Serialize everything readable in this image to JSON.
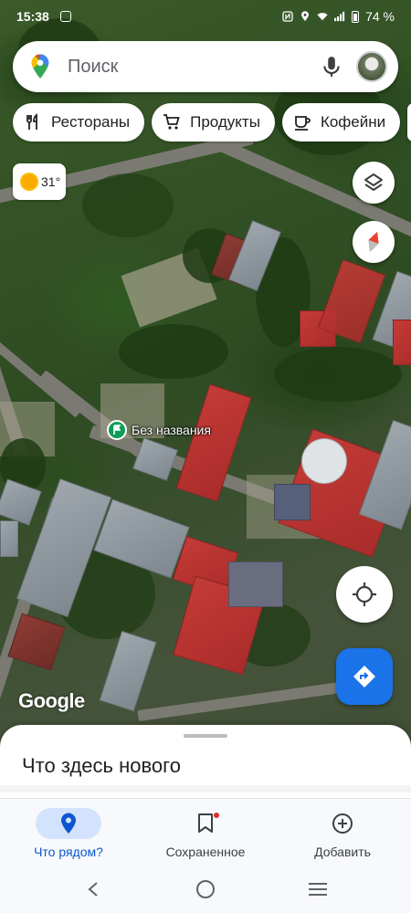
{
  "status_bar": {
    "time": "15:38",
    "battery": "74 %",
    "icons": [
      "instagram-icon",
      "nfc-icon",
      "location-icon",
      "wifi-icon",
      "signal-icon",
      "battery-icon"
    ]
  },
  "search": {
    "placeholder": "Поиск"
  },
  "chips": [
    {
      "label": "Рестораны",
      "icon": "restaurant-icon"
    },
    {
      "label": "Продукты",
      "icon": "cart-icon"
    },
    {
      "label": "Кофейни",
      "icon": "coffee-icon"
    }
  ],
  "weather": {
    "temperature": "31°",
    "icon": "sun-icon"
  },
  "map": {
    "marker_label": "Без названия",
    "logo": "Google"
  },
  "sheet": {
    "title": "Что здесь нового"
  },
  "bottom_nav": {
    "items": [
      {
        "label": "Что рядом?",
        "icon": "location-pin-icon",
        "active": true
      },
      {
        "label": "Сохраненное",
        "icon": "bookmark-icon",
        "active": false
      },
      {
        "label": "Добавить",
        "icon": "add-circle-icon",
        "active": false
      }
    ]
  },
  "colors": {
    "accent": "#1a73e8",
    "active_nav_bg": "#d3e3fd",
    "marker_green": "#0f9d58"
  }
}
